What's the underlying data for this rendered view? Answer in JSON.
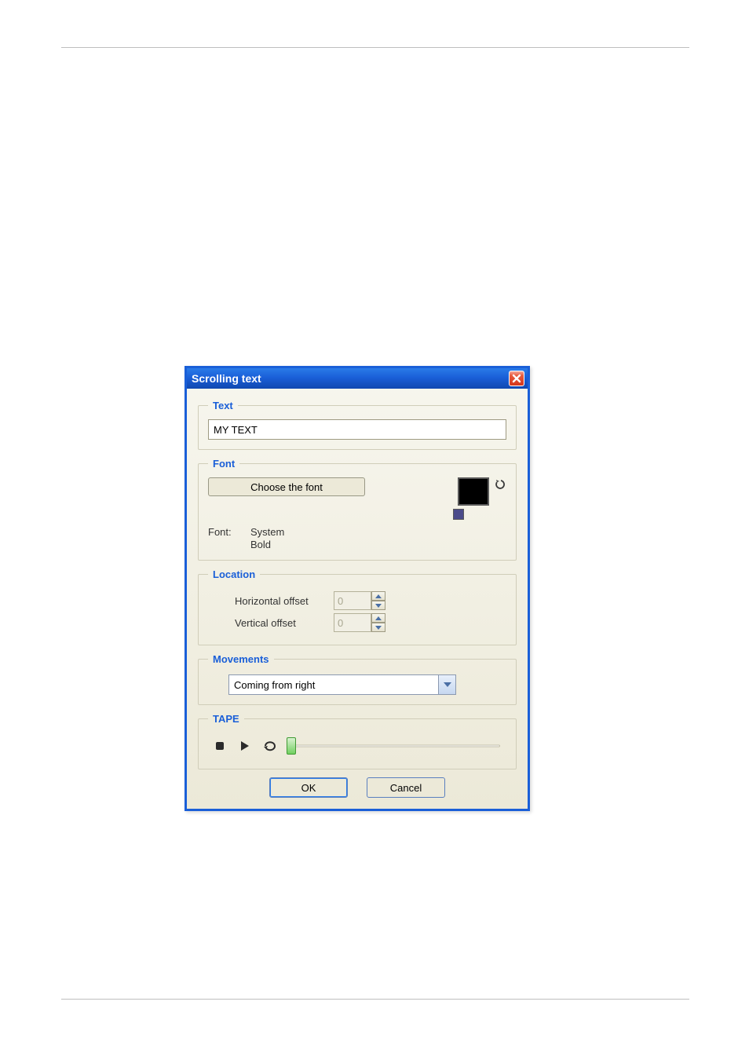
{
  "dialog": {
    "title": "Scrolling text"
  },
  "text": {
    "legend": "Text",
    "value": "MY TEXT"
  },
  "font": {
    "legend": "Font",
    "chooseLabel": "Choose the font",
    "fontLabel": "Font:",
    "name": "System",
    "style": "Bold",
    "swatch_big": "#000000",
    "swatch_small": "#4b4b8a"
  },
  "location": {
    "legend": "Location",
    "hLabel": "Horizontal offset",
    "vLabel": "Vertical offset",
    "hValue": "0",
    "vValue": "0"
  },
  "movements": {
    "legend": "Movements",
    "selected": "Coming from right"
  },
  "tape": {
    "legend": "TAPE"
  },
  "buttons": {
    "ok": "OK",
    "cancel": "Cancel"
  }
}
